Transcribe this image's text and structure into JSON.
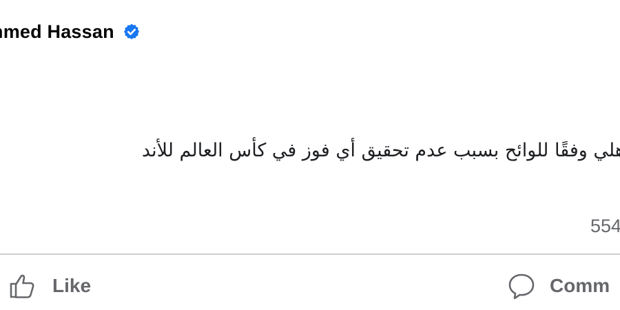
{
  "post": {
    "author_name": "hmed Hassan",
    "verified_icon": "verified-badge-icon",
    "text": "الأهلي وفقًا للوائح بسبب عدم تحقيق أي فوز في كأس العالم للأند",
    "reaction_count": "554"
  },
  "actions": {
    "like_label": "Like",
    "like_icon": "thumbs-up-icon",
    "comment_label": "Comm",
    "comment_icon": "comment-bubble-icon"
  },
  "colors": {
    "verified_blue": "#1877f2",
    "secondary_text": "#65676b",
    "divider": "#ced0d4"
  }
}
